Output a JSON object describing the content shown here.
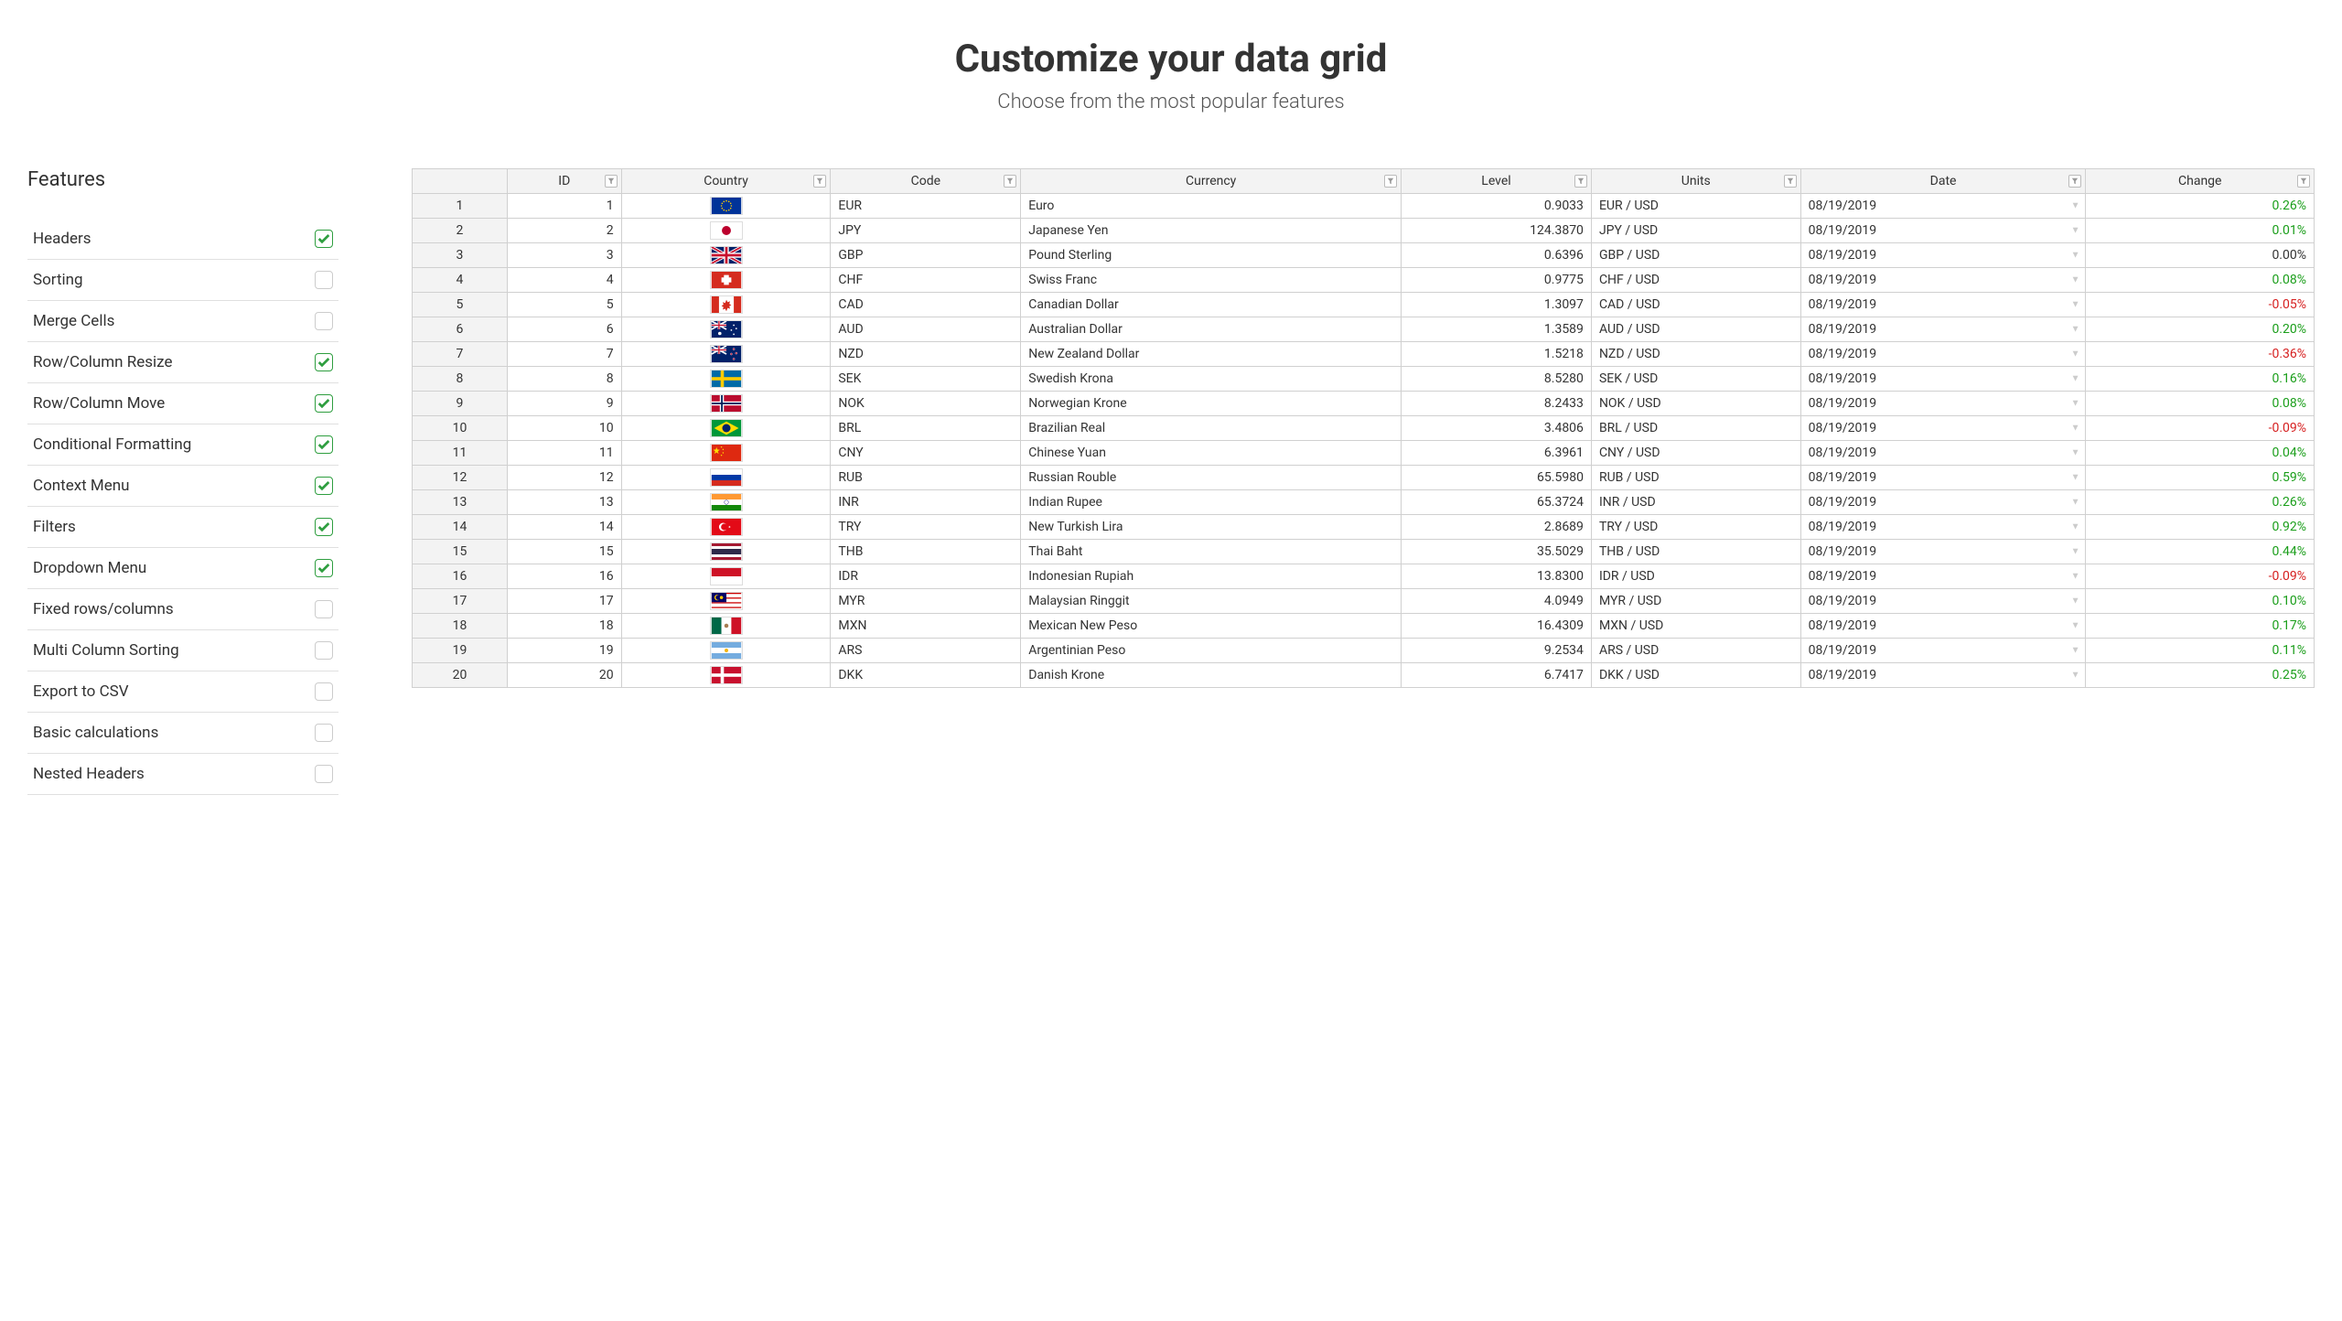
{
  "header": {
    "title": "Customize your data grid",
    "subtitle": "Choose from the most popular features"
  },
  "sidebar": {
    "title": "Features",
    "items": [
      {
        "label": "Headers",
        "checked": true
      },
      {
        "label": "Sorting",
        "checked": false
      },
      {
        "label": "Merge Cells",
        "checked": false
      },
      {
        "label": "Row/Column Resize",
        "checked": true
      },
      {
        "label": "Row/Column Move",
        "checked": true
      },
      {
        "label": "Conditional Formatting",
        "checked": true
      },
      {
        "label": "Context Menu",
        "checked": true
      },
      {
        "label": "Filters",
        "checked": true
      },
      {
        "label": "Dropdown Menu",
        "checked": true
      },
      {
        "label": "Fixed rows/columns",
        "checked": false
      },
      {
        "label": "Multi Column Sorting",
        "checked": false
      },
      {
        "label": "Export to CSV",
        "checked": false
      },
      {
        "label": "Basic calculations",
        "checked": false
      },
      {
        "label": "Nested Headers",
        "checked": false
      }
    ]
  },
  "grid": {
    "columns": [
      "ID",
      "Country",
      "Code",
      "Currency",
      "Level",
      "Units",
      "Date",
      "Change"
    ],
    "rows": [
      {
        "n": 1,
        "id": 1,
        "country": "EU",
        "code": "EUR",
        "currency": "Euro",
        "level": "0.9033",
        "units": "EUR / USD",
        "date": "08/19/2019",
        "change": "0.26%",
        "sign": 1
      },
      {
        "n": 2,
        "id": 2,
        "country": "JP",
        "code": "JPY",
        "currency": "Japanese Yen",
        "level": "124.3870",
        "units": "JPY / USD",
        "date": "08/19/2019",
        "change": "0.01%",
        "sign": 1
      },
      {
        "n": 3,
        "id": 3,
        "country": "GB",
        "code": "GBP",
        "currency": "Pound Sterling",
        "level": "0.6396",
        "units": "GBP / USD",
        "date": "08/19/2019",
        "change": "0.00%",
        "sign": 0
      },
      {
        "n": 4,
        "id": 4,
        "country": "CH",
        "code": "CHF",
        "currency": "Swiss Franc",
        "level": "0.9775",
        "units": "CHF / USD",
        "date": "08/19/2019",
        "change": "0.08%",
        "sign": 1
      },
      {
        "n": 5,
        "id": 5,
        "country": "CA",
        "code": "CAD",
        "currency": "Canadian Dollar",
        "level": "1.3097",
        "units": "CAD / USD",
        "date": "08/19/2019",
        "change": "-0.05%",
        "sign": -1
      },
      {
        "n": 6,
        "id": 6,
        "country": "AU",
        "code": "AUD",
        "currency": "Australian Dollar",
        "level": "1.3589",
        "units": "AUD / USD",
        "date": "08/19/2019",
        "change": "0.20%",
        "sign": 1
      },
      {
        "n": 7,
        "id": 7,
        "country": "NZ",
        "code": "NZD",
        "currency": "New Zealand Dollar",
        "level": "1.5218",
        "units": "NZD / USD",
        "date": "08/19/2019",
        "change": "-0.36%",
        "sign": -1
      },
      {
        "n": 8,
        "id": 8,
        "country": "SE",
        "code": "SEK",
        "currency": "Swedish Krona",
        "level": "8.5280",
        "units": "SEK / USD",
        "date": "08/19/2019",
        "change": "0.16%",
        "sign": 1
      },
      {
        "n": 9,
        "id": 9,
        "country": "NO",
        "code": "NOK",
        "currency": "Norwegian Krone",
        "level": "8.2433",
        "units": "NOK / USD",
        "date": "08/19/2019",
        "change": "0.08%",
        "sign": 1
      },
      {
        "n": 10,
        "id": 10,
        "country": "BR",
        "code": "BRL",
        "currency": "Brazilian Real",
        "level": "3.4806",
        "units": "BRL / USD",
        "date": "08/19/2019",
        "change": "-0.09%",
        "sign": -1
      },
      {
        "n": 11,
        "id": 11,
        "country": "CN",
        "code": "CNY",
        "currency": "Chinese Yuan",
        "level": "6.3961",
        "units": "CNY / USD",
        "date": "08/19/2019",
        "change": "0.04%",
        "sign": 1
      },
      {
        "n": 12,
        "id": 12,
        "country": "RU",
        "code": "RUB",
        "currency": "Russian Rouble",
        "level": "65.5980",
        "units": "RUB / USD",
        "date": "08/19/2019",
        "change": "0.59%",
        "sign": 1
      },
      {
        "n": 13,
        "id": 13,
        "country": "IN",
        "code": "INR",
        "currency": "Indian Rupee",
        "level": "65.3724",
        "units": "INR / USD",
        "date": "08/19/2019",
        "change": "0.26%",
        "sign": 1
      },
      {
        "n": 14,
        "id": 14,
        "country": "TR",
        "code": "TRY",
        "currency": "New Turkish Lira",
        "level": "2.8689",
        "units": "TRY / USD",
        "date": "08/19/2019",
        "change": "0.92%",
        "sign": 1
      },
      {
        "n": 15,
        "id": 15,
        "country": "TH",
        "code": "THB",
        "currency": "Thai Baht",
        "level": "35.5029",
        "units": "THB / USD",
        "date": "08/19/2019",
        "change": "0.44%",
        "sign": 1
      },
      {
        "n": 16,
        "id": 16,
        "country": "ID",
        "code": "IDR",
        "currency": "Indonesian Rupiah",
        "level": "13.8300",
        "units": "IDR / USD",
        "date": "08/19/2019",
        "change": "-0.09%",
        "sign": -1
      },
      {
        "n": 17,
        "id": 17,
        "country": "MY",
        "code": "MYR",
        "currency": "Malaysian Ringgit",
        "level": "4.0949",
        "units": "MYR / USD",
        "date": "08/19/2019",
        "change": "0.10%",
        "sign": 1
      },
      {
        "n": 18,
        "id": 18,
        "country": "MX",
        "code": "MXN",
        "currency": "Mexican New Peso",
        "level": "16.4309",
        "units": "MXN / USD",
        "date": "08/19/2019",
        "change": "0.17%",
        "sign": 1
      },
      {
        "n": 19,
        "id": 19,
        "country": "AR",
        "code": "ARS",
        "currency": "Argentinian Peso",
        "level": "9.2534",
        "units": "ARS / USD",
        "date": "08/19/2019",
        "change": "0.11%",
        "sign": 1
      },
      {
        "n": 20,
        "id": 20,
        "country": "DK",
        "code": "DKK",
        "currency": "Danish Krone",
        "level": "6.7417",
        "units": "DKK / USD",
        "date": "08/19/2019",
        "change": "0.25%",
        "sign": 1
      }
    ]
  }
}
